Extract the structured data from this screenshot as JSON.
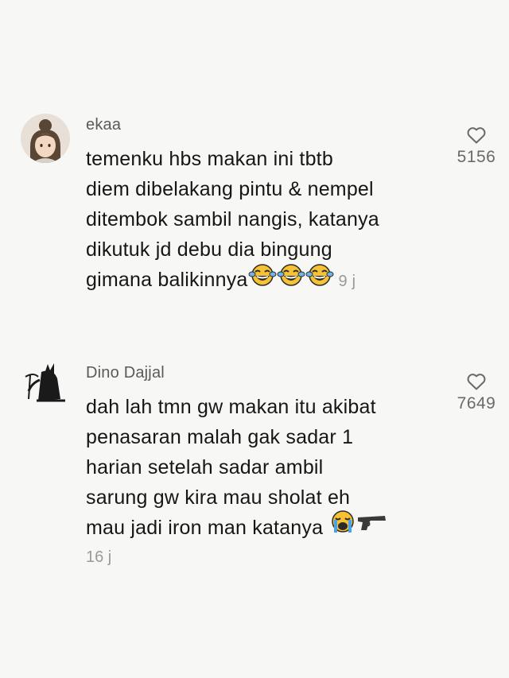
{
  "comments": [
    {
      "username": "ekaa",
      "lines": [
        "temenku hbs makan ini tbtb",
        "diem dibelakang pintu & nempel",
        "ditembok sambil nangis, katanya",
        "dikutuk jd debu dia bingung",
        "gimana balikinnya"
      ],
      "emojis": [
        "laughing-tears-emoji",
        "laughing-tears-emoji",
        "laughing-tears-emoji"
      ],
      "time": "9 j",
      "likes": "5156",
      "like_icon": "heart-outline-icon"
    },
    {
      "username": "Dino Dajjal",
      "lines": [
        "dah lah tmn gw makan itu akibat",
        "penasaran malah gak sadar 1",
        "harian setelah sadar ambil",
        "sarung gw kira mau sholat eh",
        "mau jadi iron man katanya"
      ],
      "emojis": [
        "loudly-crying-emoji",
        "pistol-emoji"
      ],
      "time": "16 j",
      "likes": "7649",
      "like_icon": "heart-outline-icon"
    }
  ]
}
